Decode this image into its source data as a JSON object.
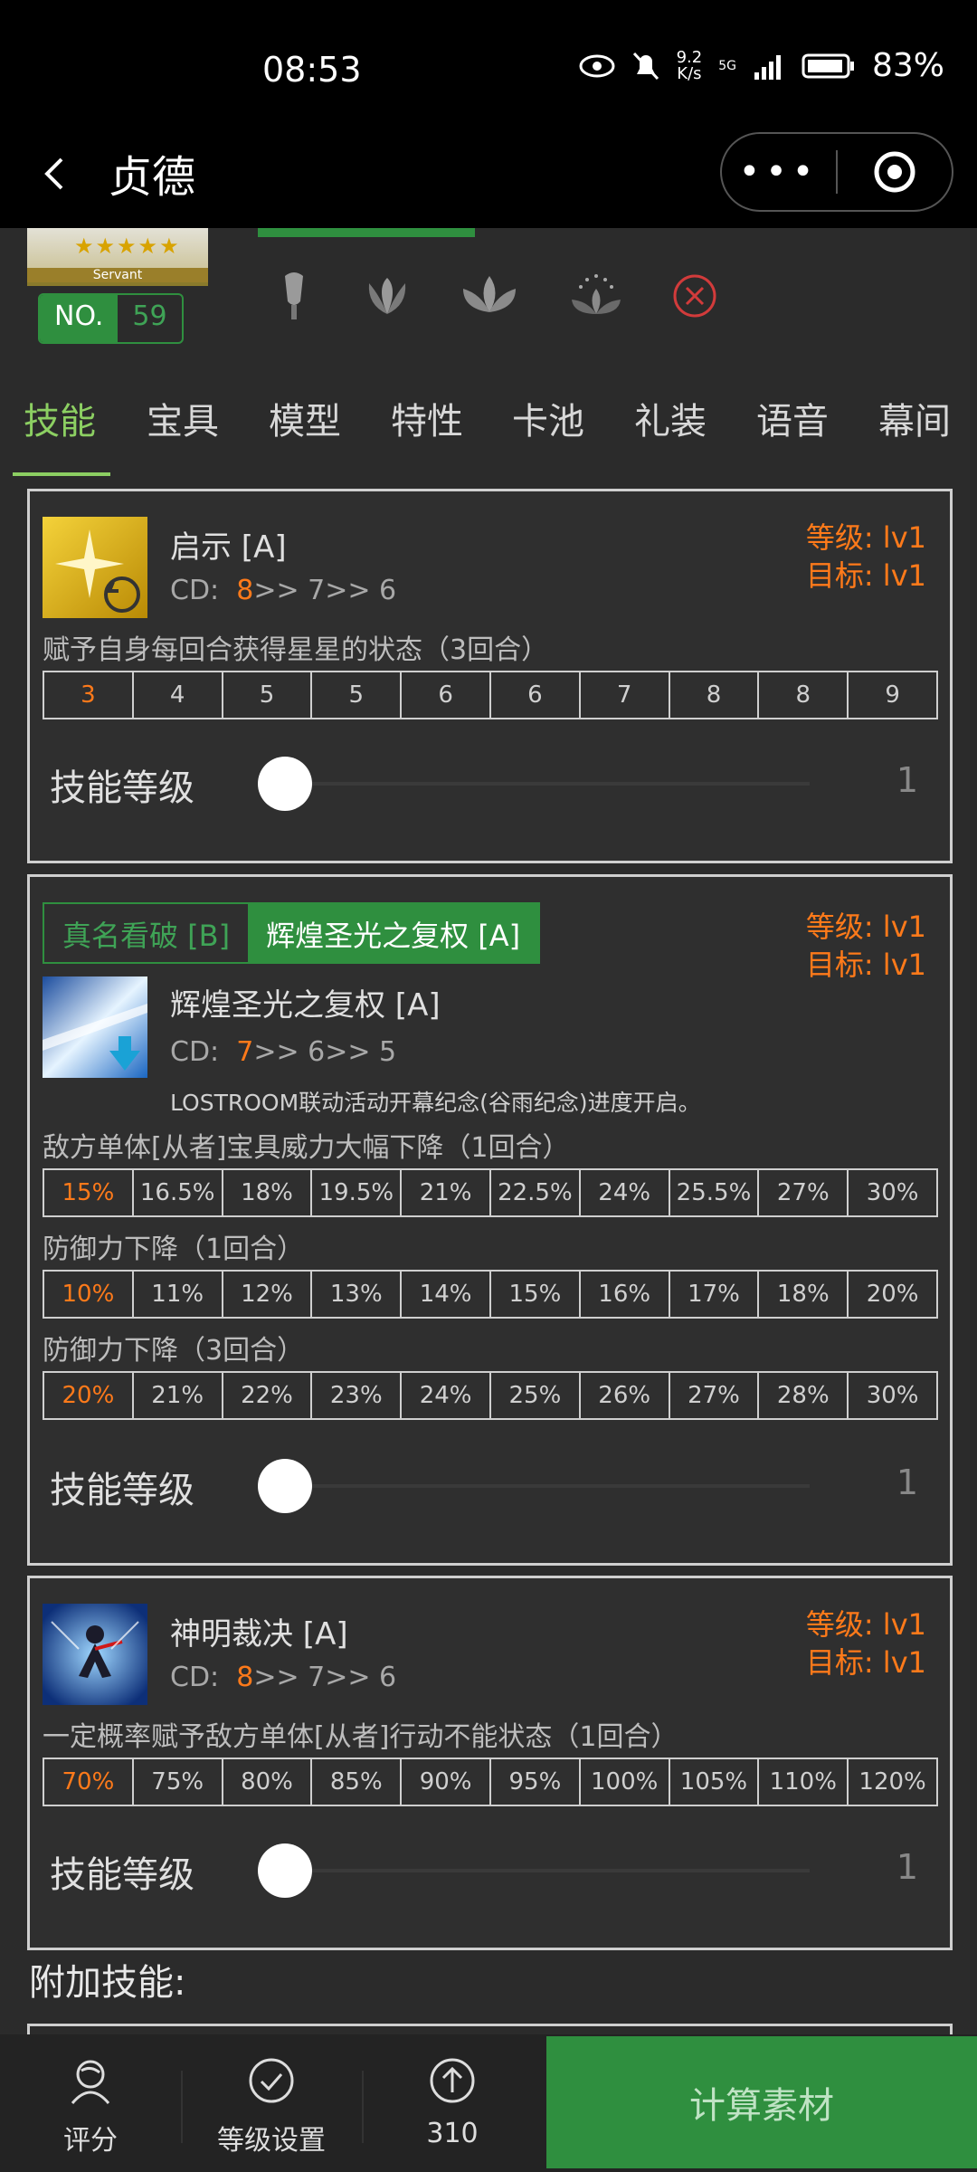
{
  "status_bar": {
    "time": "08:53",
    "net_speed_top": "9.2",
    "net_speed_bottom": "K/s",
    "signal": "5G",
    "battery": "83%"
  },
  "header": {
    "title": "贞德",
    "more_icon": "more-dots-icon",
    "target_icon": "target-icon"
  },
  "servant": {
    "card_label": "Servant",
    "no_label": "NO.",
    "no_value": "59"
  },
  "tabs": [
    "技能",
    "宝具",
    "模型",
    "特性",
    "卡池",
    "礼装",
    "语音",
    "幕间"
  ],
  "skills": [
    {
      "name": "启示 [A]",
      "cd_label": "CD:",
      "cd_first": "8",
      "cd_rest": ">> 7>> 6",
      "level_label": "等级: lv1",
      "target_label": "目标: lv1",
      "effects": [
        {
          "desc": "赋予自身每回合获得星星的状态（3回合）",
          "values": [
            "3",
            "4",
            "5",
            "5",
            "6",
            "6",
            "7",
            "8",
            "8",
            "9"
          ]
        }
      ],
      "slider_label": "技能等级",
      "slider_value": "1"
    },
    {
      "tab_left": "真名看破 [B]",
      "tab_right": "辉煌圣光之复权 [A]",
      "name": "辉煌圣光之复权 [A]",
      "cd_label": "CD:",
      "cd_first": "7",
      "cd_rest": ">> 6>> 5",
      "note": "LOSTROOM联动活动开幕纪念(谷雨纪念)进度开启。",
      "level_label": "等级: lv1",
      "target_label": "目标: lv1",
      "effects": [
        {
          "desc": "敌方单体[从者]宝具威力大幅下降（1回合）",
          "values": [
            "15%",
            "16.5%",
            "18%",
            "19.5%",
            "21%",
            "22.5%",
            "24%",
            "25.5%",
            "27%",
            "30%"
          ]
        },
        {
          "desc": "防御力下降（1回合）",
          "values": [
            "10%",
            "11%",
            "12%",
            "13%",
            "14%",
            "15%",
            "16%",
            "17%",
            "18%",
            "20%"
          ]
        },
        {
          "desc": "防御力下降（3回合）",
          "values": [
            "20%",
            "21%",
            "22%",
            "23%",
            "24%",
            "25%",
            "26%",
            "27%",
            "28%",
            "30%"
          ]
        }
      ],
      "slider_label": "技能等级",
      "slider_value": "1"
    },
    {
      "name": "神明裁决 [A]",
      "cd_label": "CD:",
      "cd_first": "8",
      "cd_rest": ">> 7>> 6",
      "level_label": "等级: lv1",
      "target_label": "目标: lv1",
      "effects": [
        {
          "desc": "一定概率赋予敌方单体[从者]行动不能状态（1回合）",
          "values": [
            "70%",
            "75%",
            "80%",
            "85%",
            "90%",
            "95%",
            "100%",
            "105%",
            "110%",
            "120%"
          ]
        }
      ],
      "slider_label": "技能等级",
      "slider_value": "1"
    }
  ],
  "extra_skills_title": "附加技能:",
  "bottom_bar": {
    "rate_label": "评分",
    "level_setting_label": "等级设置",
    "up_count": "310",
    "calc_button": "计算素材"
  },
  "colors": {
    "accent_green": "#2f8f3f",
    "tab_active": "#8ccf62",
    "orange": "#ff7a1a"
  }
}
